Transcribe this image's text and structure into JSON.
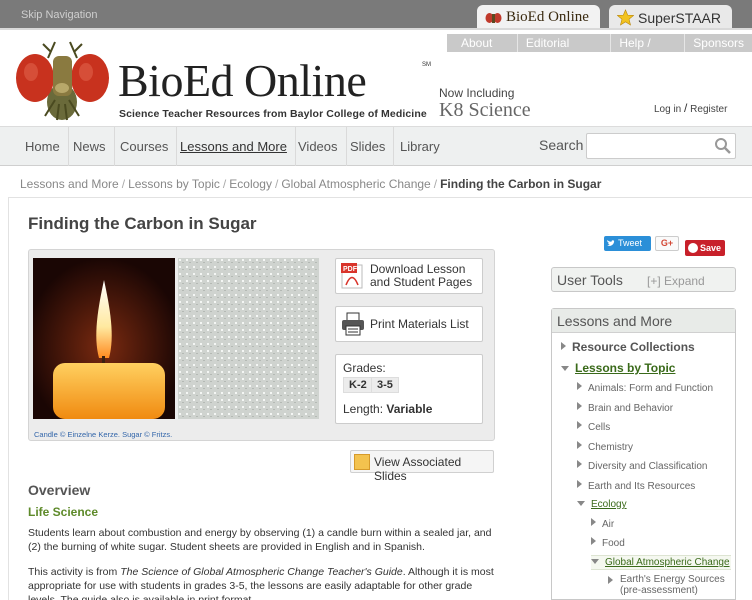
{
  "topbar": {
    "skip": "Skip Navigation",
    "tab_bioed": "BioEd Online",
    "tab_staar": "SuperSTAAR"
  },
  "utility": [
    "About Us",
    "Editorial Board",
    "Help / FAQ",
    "Sponsors"
  ],
  "header": {
    "logo": "BioEd Online",
    "sm": "SM",
    "tagline": "Science Teacher Resources from Baylor College of Medicine",
    "now_including": "Now Including",
    "k8": "K8 Science",
    "login": "Log in",
    "slash": "/",
    "register": "Register"
  },
  "nav": {
    "home": "Home",
    "news": "News",
    "courses": "Courses",
    "lessons": "Lessons and More",
    "videos": "Videos",
    "slides": "Slides",
    "library": "Library",
    "search_label": "Search",
    "search_value": ""
  },
  "breadcrumb": {
    "c1": "Lessons and More",
    "c2": "Lessons by Topic",
    "c3": "Ecology",
    "c4": "Global Atmospheric Change",
    "current": "Finding the Carbon in Sugar",
    "sep": "/"
  },
  "page": {
    "title": "Finding the Carbon in Sugar",
    "credit": "Candle © Einzelne Kerze. Sugar © Fritzs.",
    "download": "Download Lesson and Student Pages",
    "download_l1": "Download Lesson",
    "download_l2": "and Student Pages",
    "print": "Print Materials List",
    "grades_label": "Grades:",
    "grades": [
      "K-2",
      "3-5"
    ],
    "length_label": "Length:",
    "length_value": "Variable",
    "slides_btn": "View Associated Slides",
    "overview_title": "Overview",
    "overview_sub": "Life Science",
    "p1": "Students learn about combustion and energy by observing (1) a candle burn within a sealed jar, and (2) the burning of white sugar. Student sheets are provided in English and in Spanish.",
    "p2a": "This activity is from ",
    "p2_em": "The Science of Global Atmospheric Change Teacher's Guide",
    "p2b": ". Although it is most appropriate for use with students in grades 3-5, the lessons are easily adaptable for other grade levels. The guide also is available in print format."
  },
  "social": {
    "tweet": "Tweet",
    "gplus": "G+",
    "save": "Save"
  },
  "sidebar": {
    "user_tools": "User Tools",
    "expand": "[+] Expand",
    "lam": "Lessons and More",
    "resource": "Resource Collections",
    "by_topic": "Lessons by Topic",
    "topics": [
      "Animals: Form and Function",
      "Brain and Behavior",
      "Cells",
      "Chemistry",
      "Diversity and Classification",
      "Earth and Its Resources",
      "Ecology"
    ],
    "ecology_sub": [
      "Air",
      "Food",
      "Global Atmospheric Change"
    ],
    "gac_sub": [
      "Earth's Energy Sources (pre-assessment)"
    ]
  },
  "colors": {
    "accent_green": "#5e8a2a",
    "tweet_blue": "#2b8fd8",
    "save_red": "#c8202a"
  }
}
